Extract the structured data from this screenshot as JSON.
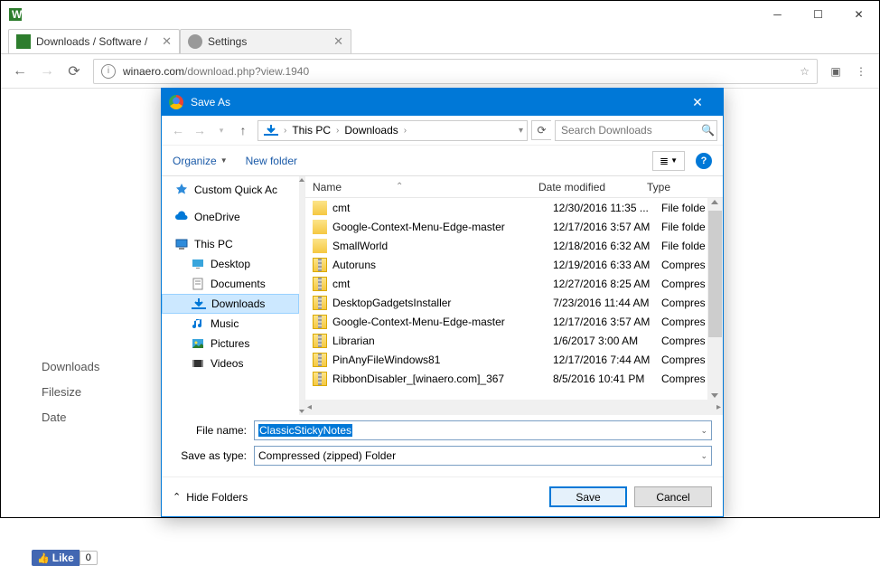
{
  "browser": {
    "tabs": [
      {
        "title": "Downloads / Software /",
        "active": true
      },
      {
        "title": "Settings",
        "active": false
      }
    ],
    "url": {
      "host": "winaero.com",
      "path": "/download.php?view.1940"
    }
  },
  "page": {
    "labels": {
      "downloads": "Downloads",
      "filesize": "Filesize",
      "date": "Date"
    },
    "fb": {
      "like": "Like",
      "count": "0"
    }
  },
  "dialog": {
    "title": "Save As",
    "breadcrumbs": [
      "This PC",
      "Downloads"
    ],
    "search_placeholder": "Search Downloads",
    "toolbar": {
      "organize": "Organize",
      "new_folder": "New folder"
    },
    "nav": [
      {
        "label": "Custom Quick Ac",
        "icon": "star",
        "indent": false,
        "sel": false
      },
      {
        "label": "OneDrive",
        "icon": "cloud",
        "indent": false,
        "sel": false
      },
      {
        "label": "This PC",
        "icon": "pc",
        "indent": false,
        "sel": false
      },
      {
        "label": "Desktop",
        "icon": "desktop",
        "indent": true,
        "sel": false
      },
      {
        "label": "Documents",
        "icon": "docs",
        "indent": true,
        "sel": false
      },
      {
        "label": "Downloads",
        "icon": "down",
        "indent": true,
        "sel": true
      },
      {
        "label": "Music",
        "icon": "music",
        "indent": true,
        "sel": false
      },
      {
        "label": "Pictures",
        "icon": "pics",
        "indent": true,
        "sel": false
      },
      {
        "label": "Videos",
        "icon": "video",
        "indent": true,
        "sel": false
      }
    ],
    "columns": {
      "name": "Name",
      "date": "Date modified",
      "type": "Type"
    },
    "files": [
      {
        "name": "cmt",
        "date": "12/30/2016 11:35 ...",
        "type": "File folde",
        "kind": "folder"
      },
      {
        "name": "Google-Context-Menu-Edge-master",
        "date": "12/17/2016 3:57 AM",
        "type": "File folde",
        "kind": "folder"
      },
      {
        "name": "SmallWorld",
        "date": "12/18/2016 6:32 AM",
        "type": "File folde",
        "kind": "folder"
      },
      {
        "name": "Autoruns",
        "date": "12/19/2016 6:33 AM",
        "type": "Compres",
        "kind": "zip"
      },
      {
        "name": "cmt",
        "date": "12/27/2016 8:25 AM",
        "type": "Compres",
        "kind": "zip"
      },
      {
        "name": "DesktopGadgetsInstaller",
        "date": "7/23/2016 11:44 AM",
        "type": "Compres",
        "kind": "zip"
      },
      {
        "name": "Google-Context-Menu-Edge-master",
        "date": "12/17/2016 3:57 AM",
        "type": "Compres",
        "kind": "zip"
      },
      {
        "name": "Librarian",
        "date": "1/6/2017 3:00 AM",
        "type": "Compres",
        "kind": "zip"
      },
      {
        "name": "PinAnyFileWindows81",
        "date": "12/17/2016 7:44 AM",
        "type": "Compres",
        "kind": "zip"
      },
      {
        "name": "RibbonDisabler_[winaero.com]_367",
        "date": "8/5/2016 10:41 PM",
        "type": "Compres",
        "kind": "zip"
      }
    ],
    "filename_label": "File name:",
    "filename_value": "ClassicStickyNotes",
    "savetype_label": "Save as type:",
    "savetype_value": "Compressed (zipped) Folder",
    "hide_folders": "Hide Folders",
    "save": "Save",
    "cancel": "Cancel"
  }
}
